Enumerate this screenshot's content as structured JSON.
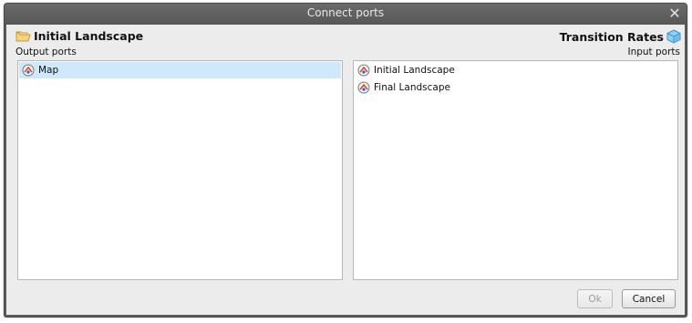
{
  "window": {
    "title": "Connect ports",
    "close_label": "✕"
  },
  "left": {
    "title": "Initial Landscape",
    "icon": "folder-icon",
    "subtitle": "Output ports",
    "items": [
      {
        "label": "Map",
        "selected": true
      }
    ]
  },
  "right": {
    "title": "Transition Rates",
    "icon": "cube-icon",
    "subtitle": "Input ports",
    "items": [
      {
        "label": "Initial Landscape",
        "selected": false
      },
      {
        "label": "Final Landscape",
        "selected": false
      }
    ]
  },
  "buttons": {
    "ok": "Ok",
    "cancel": "Cancel"
  },
  "colors": {
    "titlebar": "#5a5a5a",
    "selection": "#cfe8fb",
    "folder": "#f2c14e",
    "cube": "#5ab0e8"
  }
}
